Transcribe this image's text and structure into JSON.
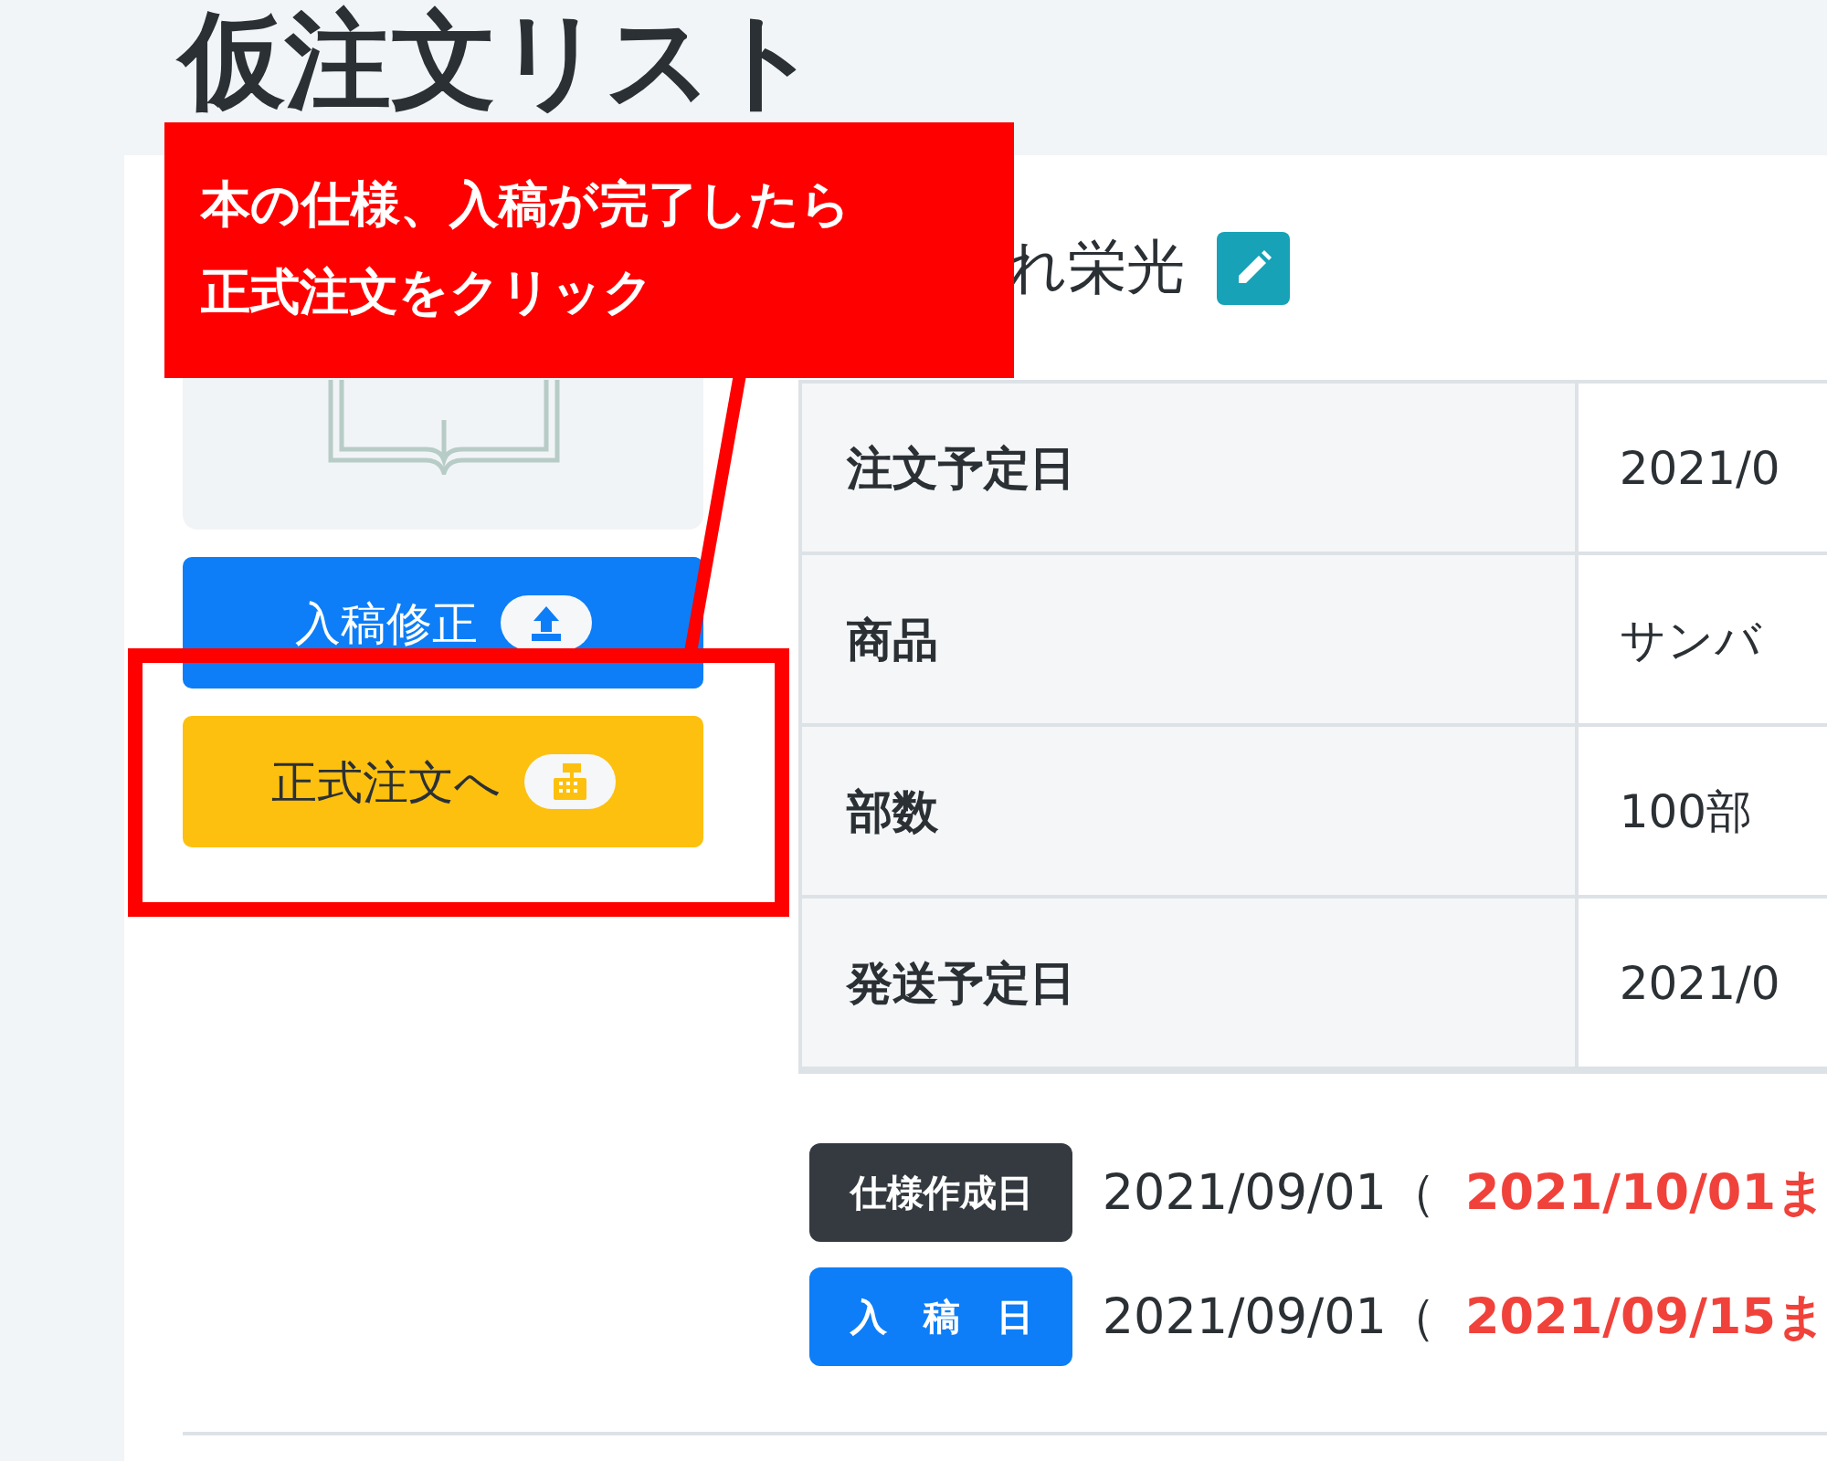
{
  "page": {
    "title": "仮注文リスト"
  },
  "callout": {
    "lines": [
      "本の仕様、入稿が完了したら",
      "正式注文をクリック"
    ]
  },
  "order": {
    "name": "れ栄光",
    "buttons": [
      {
        "label": "入稿修正",
        "kind": "upload"
      },
      {
        "label": "正式注文へ",
        "kind": "register"
      }
    ],
    "details": [
      {
        "label": "注文予定日",
        "value": "2021/0"
      },
      {
        "label": "商品",
        "value": "サンバ"
      },
      {
        "label": "部数",
        "value": "100部"
      },
      {
        "label": "発送予定日",
        "value": "2021/0"
      }
    ],
    "dates": [
      {
        "badge": "仕様作成日",
        "kind": "spec",
        "date": "2021/09/01（",
        "deadline": "2021/10/01ま"
      },
      {
        "badge": "入　稿　日",
        "kind": "upload",
        "date": "2021/09/01（",
        "deadline": "2021/09/15ま"
      }
    ]
  }
}
